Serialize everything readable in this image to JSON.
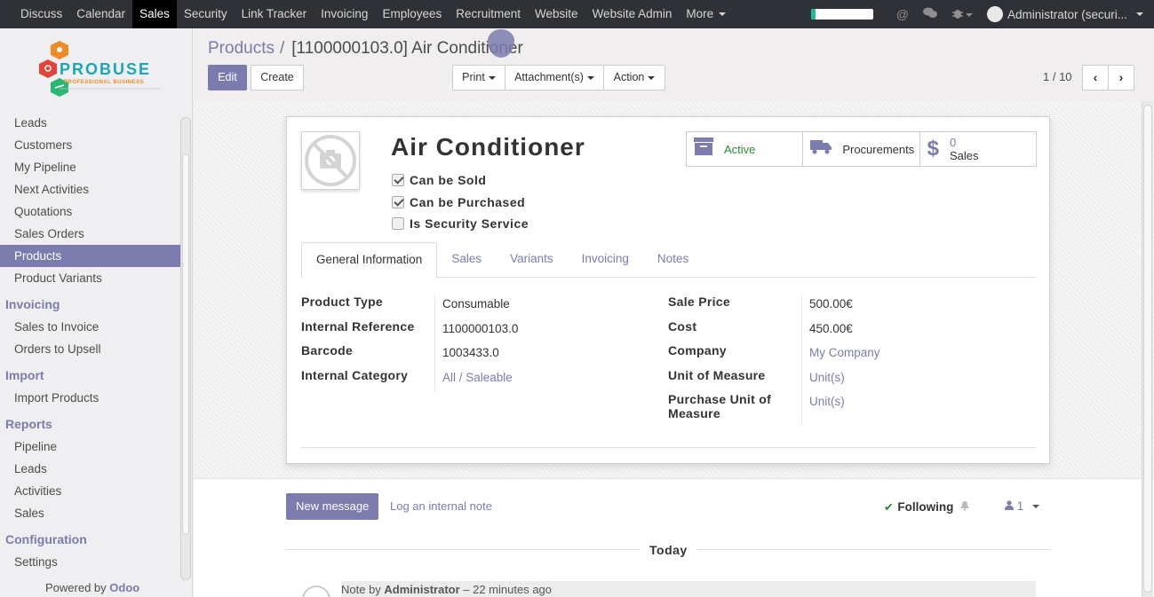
{
  "topnav": {
    "items": [
      "Discuss",
      "Calendar",
      "Sales",
      "Security",
      "Link Tracker",
      "Invoicing",
      "Employees",
      "Recruitment",
      "Website",
      "Website Admin"
    ],
    "active_index": 2,
    "more_label": "More",
    "user_label": "Administrator (securi...",
    "progress_fraction": 0.08,
    "progress_color": "#21b799",
    "icons": [
      "at-icon",
      "chat-bubbles-icon",
      "bug-icon",
      "chevron-down-icon"
    ]
  },
  "sidebar": {
    "logo": {
      "word": "PROBUSE",
      "tagline": "PROFESSIONAL BUSINESS"
    },
    "sections": [
      {
        "items": [
          "Leads",
          "Customers",
          "My Pipeline",
          "Next Activities",
          "Quotations",
          "Sales Orders",
          "Products",
          "Product Variants"
        ]
      },
      {
        "heading": "Invoicing",
        "items": [
          "Sales to Invoice",
          "Orders to Upsell"
        ]
      },
      {
        "heading": "Import",
        "items": [
          "Import Products"
        ]
      },
      {
        "heading": "Reports",
        "items": [
          "Pipeline",
          "Leads",
          "Activities",
          "Sales"
        ]
      },
      {
        "heading": "Configuration",
        "items": [
          "Settings"
        ]
      }
    ],
    "active_item": "Products",
    "powered_prefix": "Powered by ",
    "powered_brand": "Odoo"
  },
  "control_panel": {
    "breadcrumb_parent": "Products",
    "breadcrumb_separator": "/",
    "breadcrumb_current": "[1100000103.0] Air Conditioner",
    "edit_label": "Edit",
    "create_label": "Create",
    "print_label": "Print",
    "attachments_label": "Attachment(s)",
    "action_label": "Action",
    "pager": "1 / 10",
    "prev_glyph": "‹",
    "next_glyph": "›"
  },
  "product": {
    "name": "Air Conditioner",
    "checkboxes": [
      {
        "label": "Can be Sold",
        "checked": true
      },
      {
        "label": "Can be Purchased",
        "checked": true
      },
      {
        "label": "Is Security Service",
        "checked": false
      }
    ],
    "stat_buttons": {
      "active_label": "Active",
      "procurements_label": "Procurements",
      "sales_count": "0",
      "sales_label": "Sales"
    },
    "tabs": [
      "General Information",
      "Sales",
      "Variants",
      "Invoicing",
      "Notes"
    ],
    "active_tab": "General Information",
    "left_fields": [
      {
        "label": "Product Type",
        "value": "Consumable",
        "link": false
      },
      {
        "label": "Internal Reference",
        "value": "1100000103.0",
        "link": false
      },
      {
        "label": "Barcode",
        "value": "1003433.0",
        "link": false
      },
      {
        "label": "Internal Category",
        "value": "All / Saleable",
        "link": true
      }
    ],
    "right_fields": [
      {
        "label": "Sale Price",
        "value": "500.00€",
        "link": false
      },
      {
        "label": "Cost",
        "value": "450.00€",
        "link": false
      },
      {
        "label": "Company",
        "value": "My Company",
        "link": true
      },
      {
        "label": "Unit of Measure",
        "value": "Unit(s)",
        "link": true
      },
      {
        "label": "Purchase Unit of Measure",
        "value": "Unit(s)",
        "link": true
      }
    ]
  },
  "chatter": {
    "new_message_label": "New message",
    "log_note_label": "Log an internal note",
    "following_label": "Following",
    "followers_count": "1",
    "date_separator": "Today",
    "note_prefix": "Note by ",
    "note_author": "Administrator",
    "note_time": " – 22 minutes ago"
  },
  "colors": {
    "accent": "#7c7bad",
    "topbar": "#2f3136",
    "active_status": "#2c8a3c"
  }
}
